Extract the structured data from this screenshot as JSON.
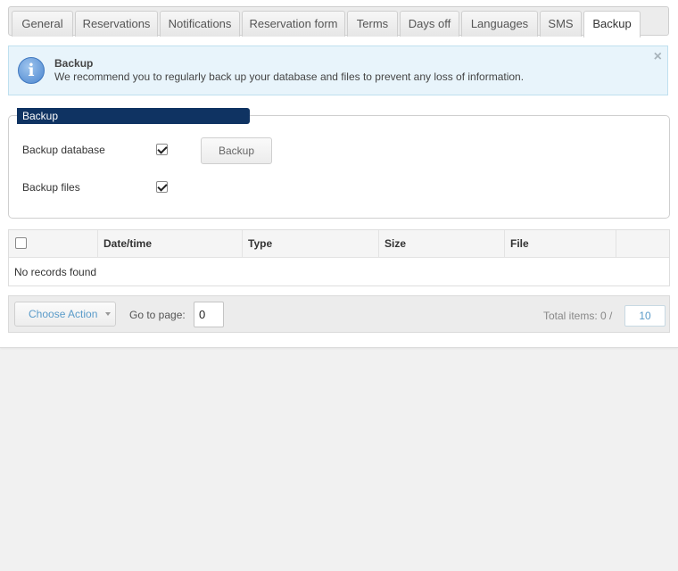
{
  "tabs": [
    {
      "label": "General",
      "active": false
    },
    {
      "label": "Reservations",
      "active": false
    },
    {
      "label": "Notifications",
      "active": false
    },
    {
      "label": "Reservation form",
      "active": false
    },
    {
      "label": "Terms",
      "active": false
    },
    {
      "label": "Days off",
      "active": false
    },
    {
      "label": "Languages",
      "active": false
    },
    {
      "label": "SMS",
      "active": false
    },
    {
      "label": "Backup",
      "active": true
    }
  ],
  "notice": {
    "title": "Backup",
    "text": "We recommend you to regularly back up your database and files to prevent any loss of information.",
    "icon": "info-icon",
    "close": "×"
  },
  "backup_form": {
    "legend": "Backup",
    "database_label": "Backup database",
    "database_checked": true,
    "files_label": "Backup files",
    "files_checked": true,
    "button_label": "Backup"
  },
  "table": {
    "columns": [
      "Date/time",
      "Type",
      "Size",
      "File"
    ],
    "select_all_checked": false,
    "empty_text": "No records found"
  },
  "footer": {
    "action_label": "Choose Action",
    "goto_label": "Go to page:",
    "page_value": "0",
    "total_label": "Total items: 0 /",
    "per_page": "10"
  },
  "colors": {
    "legend_bg": "#0f3362",
    "notice_bg": "#e8f4fb",
    "link_blue": "#5a9bc9"
  }
}
